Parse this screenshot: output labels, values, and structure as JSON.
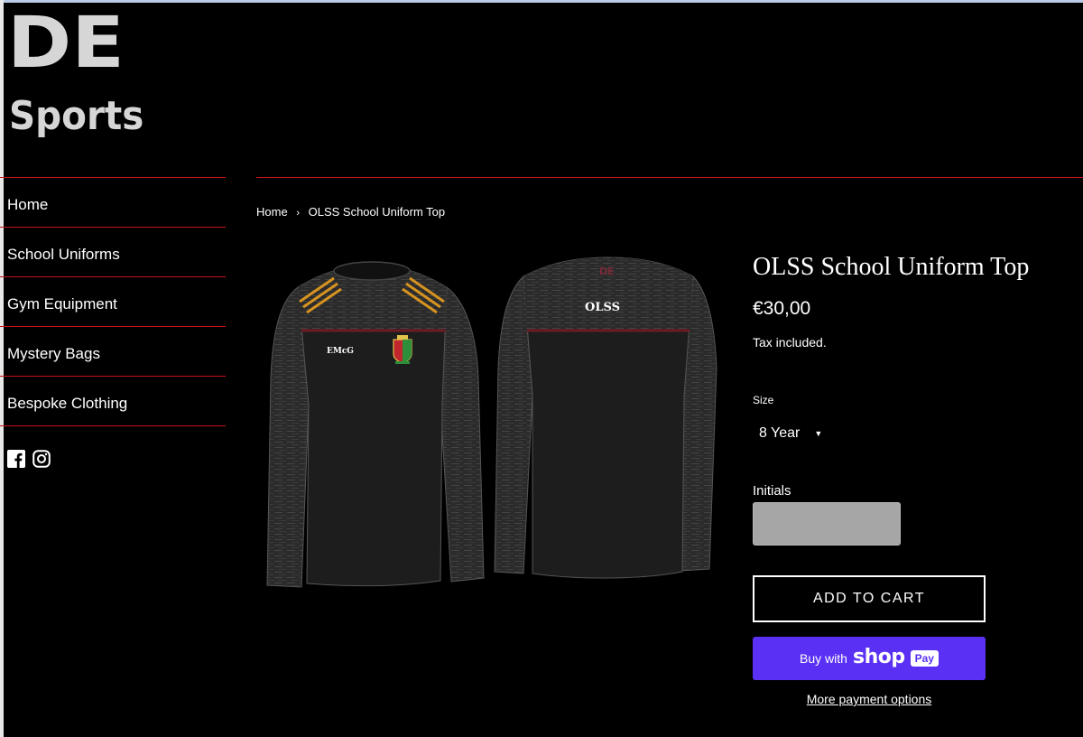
{
  "logo": {
    "line1": "DE",
    "line2": "Sports"
  },
  "nav": [
    {
      "label": "Home"
    },
    {
      "label": "School Uniforms"
    },
    {
      "label": "Gym Equipment"
    },
    {
      "label": "Mystery Bags"
    },
    {
      "label": "Bespoke Clothing"
    }
  ],
  "social": {
    "icons": [
      "facebook-icon",
      "instagram-icon"
    ]
  },
  "breadcrumb": {
    "home": "Home",
    "separator": "›",
    "current": "OLSS School Uniform Top"
  },
  "product": {
    "title": "OLSS School Uniform Top",
    "price": "€30,00",
    "tax_note": "Tax included.",
    "size_label": "Size",
    "size_value": "8 Year",
    "initials_label": "Initials",
    "initials_value": "",
    "add_to_cart": "ADD TO CART",
    "buy_with": "Buy with",
    "shop": "shop",
    "pay": "Pay",
    "more_payment": "More payment options",
    "image_front_initials": "EMcG",
    "image_back_text": "OLSS"
  },
  "colors": {
    "background": "#000000",
    "divider": "#c8101b",
    "shop_pay": "#5a31f4",
    "input_bg": "#a6a6a6"
  }
}
